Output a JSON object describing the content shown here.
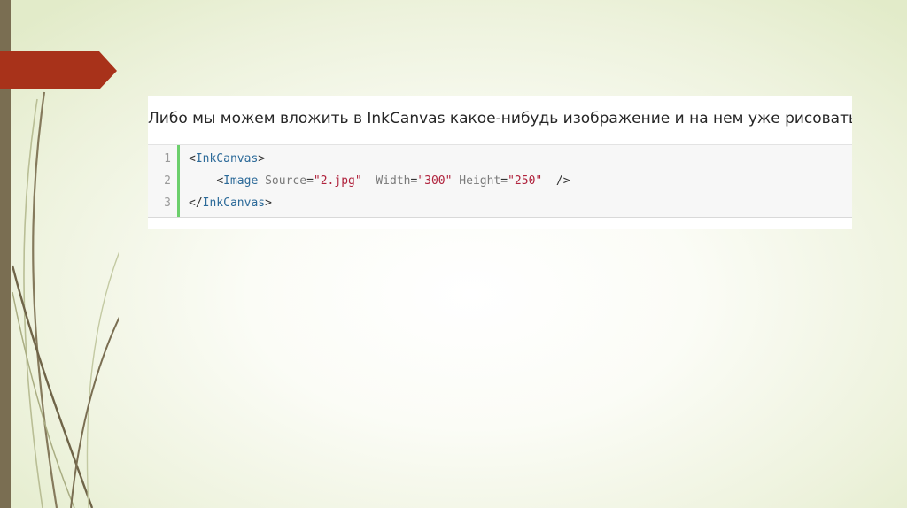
{
  "slide": {
    "intro_text": "Либо мы можем вложить в InkCanvas какое-нибудь изображение и на нем уже рисовать:",
    "colors": {
      "left_bar": "#7a6e52",
      "arrow": "#a8321a",
      "code_bar": "#6ccf6c",
      "tag": "#2c6a99",
      "value": "#b0233d"
    }
  },
  "code": {
    "line_numbers": [
      "1",
      "2",
      "3"
    ],
    "line1": {
      "open": "<",
      "tag": "InkCanvas",
      "close": ">"
    },
    "line2": {
      "indent": "    ",
      "open": "<",
      "tag": "Image",
      "attr1_name": " Source",
      "attr1_eq": "=",
      "attr1_value": "\"2.jpg\"",
      "attr2_name": "  Width",
      "attr2_eq": "=",
      "attr2_value": "\"300\"",
      "attr3_name": " Height",
      "attr3_eq": "=",
      "attr3_value": "\"250\"",
      "close": "  />"
    },
    "line3": {
      "open": "</",
      "tag": "InkCanvas",
      "close": ">"
    }
  }
}
